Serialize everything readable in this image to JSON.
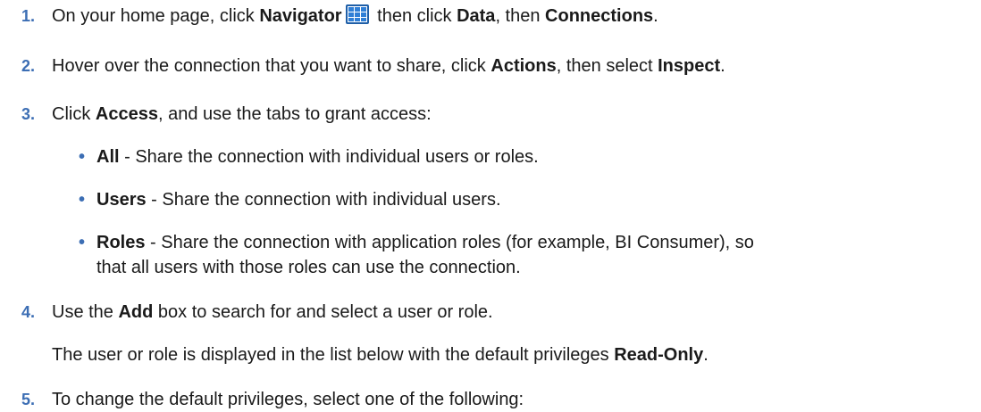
{
  "steps": [
    {
      "num": "1.",
      "p1": "On your home page, click ",
      "b1": "Navigator",
      "p2": " then click ",
      "b2": "Data",
      "p3": ", then ",
      "b3": "Connections",
      "p4": "."
    },
    {
      "num": "2.",
      "p1": "Hover over the connection that you want to share, click ",
      "b1": "Actions",
      "p2": ", then select ",
      "b2": "Inspect",
      "p3": "."
    },
    {
      "num": "3.",
      "p1": "Click ",
      "b1": "Access",
      "p2": ", and use the tabs to grant access:"
    },
    {
      "num": "4.",
      "p1": "Use the ",
      "b1": "Add",
      "p2": " box to search for and select a user or role.",
      "para_p1": "The user or role is displayed in the list below with the default privileges ",
      "para_b1": "Read-Only",
      "para_p2": "."
    },
    {
      "num": "5.",
      "p1": "To change the default privileges, select one of the following:"
    }
  ],
  "bullets": [
    {
      "dot": "•",
      "b": "All",
      "t": " - Share the connection with individual users or roles."
    },
    {
      "dot": "•",
      "b": "Users",
      "t": " - Share the connection with individual users."
    },
    {
      "dot": "•",
      "b": "Roles",
      "t": " - Share the connection with application roles (for example, BI Consumer), so",
      "t2": "that all users with those roles can use the connection."
    }
  ],
  "icons": {
    "navigator": "navigator-grid-icon",
    "navigator_color": "#2f7fd6"
  },
  "colors": {
    "accent": "#3c6eb4",
    "text": "#1a1a1a"
  }
}
